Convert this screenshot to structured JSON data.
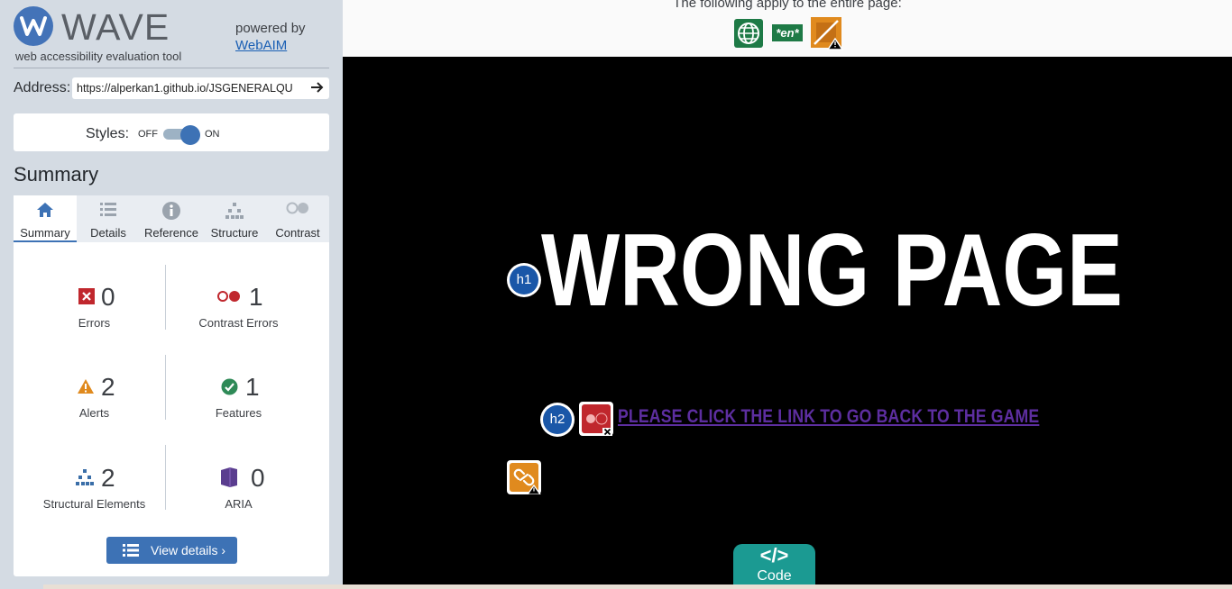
{
  "sidebar": {
    "brand": "WAVE",
    "tagline": "web accessibility evaluation tool",
    "powered_by": "powered by",
    "powered_link": "WebAIM",
    "address_label": "Address:",
    "address_value": "https://alperkan1.github.io/JSGENERALQU",
    "styles_label": "Styles:",
    "toggle_off": "OFF",
    "toggle_on": "ON",
    "summary_heading": "Summary",
    "tabs": [
      {
        "label": "Summary",
        "icon": "home-icon"
      },
      {
        "label": "Details",
        "icon": "list-icon"
      },
      {
        "label": "Reference",
        "icon": "info-icon"
      },
      {
        "label": "Structure",
        "icon": "hierarchy-icon"
      },
      {
        "label": "Contrast",
        "icon": "contrast-icon"
      }
    ],
    "stats": {
      "errors": {
        "count": "0",
        "label": "Errors"
      },
      "contrast_errors": {
        "count": "1",
        "label": "Contrast Errors"
      },
      "alerts": {
        "count": "2",
        "label": "Alerts"
      },
      "features": {
        "count": "1",
        "label": "Features"
      },
      "structural": {
        "count": "2",
        "label": "Structural Elements"
      },
      "aria": {
        "count": "0",
        "label": "ARIA"
      }
    },
    "view_details": "View details ›"
  },
  "main": {
    "entire_page_text": "The following apply to the entire page:",
    "lang_badge": "*en*",
    "heading": "WRONG PAGE",
    "h1_badge": "h1",
    "h2_badge": "h2",
    "link_text": "PLEASE CLICK THE LINK TO GO BACK TO THE GAME",
    "code_icon": "</>",
    "code_label": "Code"
  },
  "colors": {
    "accent": "#3d72b5",
    "error": "#c0272d",
    "alert": "#e08a1e",
    "feature": "#2e8a57",
    "aria": "#5a3d8f",
    "code_tab": "#1b9a92"
  }
}
